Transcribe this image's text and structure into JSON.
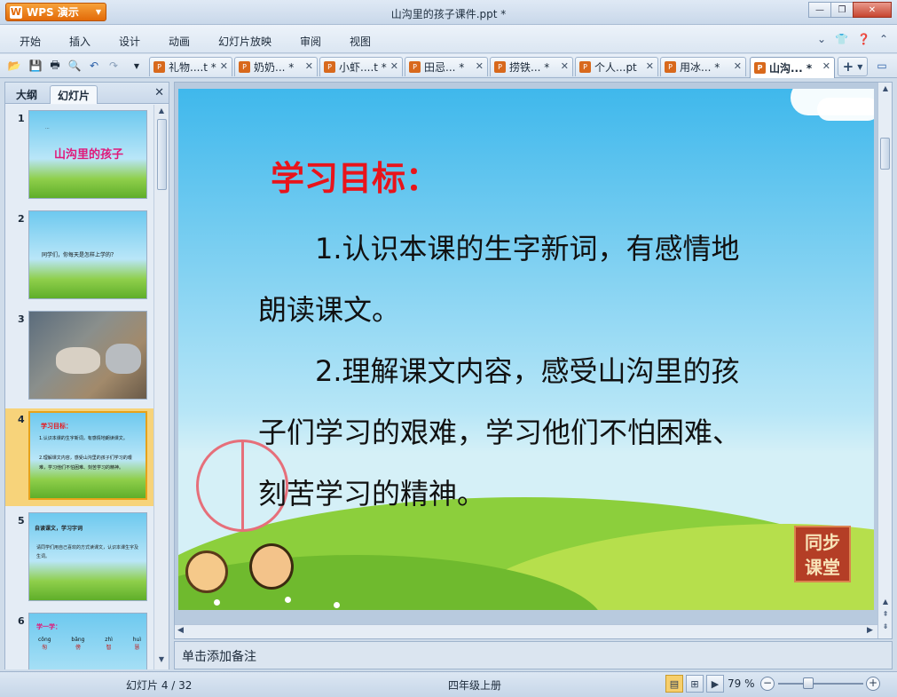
{
  "app": {
    "name": "WPS 演示",
    "logo_letter": "W",
    "title": "山沟里的孩子课件.ppt *"
  },
  "window_controls": {
    "minimize": "—",
    "restore": "❐",
    "close": "✕"
  },
  "menu": [
    "开始",
    "插入",
    "设计",
    "动画",
    "幻灯片放映",
    "审阅",
    "视图"
  ],
  "doc_tabs": [
    {
      "label": "礼物....t *",
      "active": false
    },
    {
      "label": "奶奶... *",
      "active": false
    },
    {
      "label": "小虾....t *",
      "active": false
    },
    {
      "label": "田忌... *",
      "active": false
    },
    {
      "label": "捞铁... *",
      "active": false
    },
    {
      "label": "个人...pt",
      "active": false
    },
    {
      "label": "用冰... *",
      "active": false
    },
    {
      "label": "山沟... *",
      "active": true
    }
  ],
  "left_pane": {
    "tabs": [
      "大纲",
      "幻灯片"
    ],
    "active_tab": "幻灯片",
    "close": "✕"
  },
  "thumbnails": [
    {
      "num": "1",
      "lines": [
        "...",
        "山沟里的孩子"
      ]
    },
    {
      "num": "2",
      "lines": [
        "同学们，你每天是怎样上学的？"
      ]
    },
    {
      "num": "3",
      "lines": []
    },
    {
      "num": "4",
      "lines": [
        "学习目标：",
        "1.认识本课的生字新词，有感情地朗读课文。",
        "2.理解课文内容，感受山沟里的孩子们学习的艰难，学习他们不怕困难、刻苦学习的精神。"
      ]
    },
    {
      "num": "5",
      "lines": [
        "自读课文，学习字词",
        "请同学们用自己喜欢的方式读课文，认识本课生字及生词。"
      ]
    },
    {
      "num": "6",
      "lines": [
        "学一学："
      ]
    }
  ],
  "thumb6_pinyin": [
    {
      "py": "cōng",
      "hz": "匆"
    },
    {
      "py": "bǎng",
      "hz": "傍"
    },
    {
      "py": "zhì",
      "hz": "智"
    },
    {
      "py": "huì",
      "hz": "慧"
    }
  ],
  "slide": {
    "title": "学习目标：",
    "points": [
      "1.认识本课的生字新词，有感情地朗读课文。",
      "2.理解课文内容，感受山沟里的孩子们学习的艰难，学习他们不怕困难、刻苦学习的精神。"
    ],
    "badge_line1": "同步",
    "badge_line2": "课堂"
  },
  "notes_placeholder": "单击添加备注",
  "status": {
    "slide_position": "幻灯片 4 / 32",
    "template": "四年级上册",
    "zoom": "79 %",
    "zoom_level": 0.35
  }
}
